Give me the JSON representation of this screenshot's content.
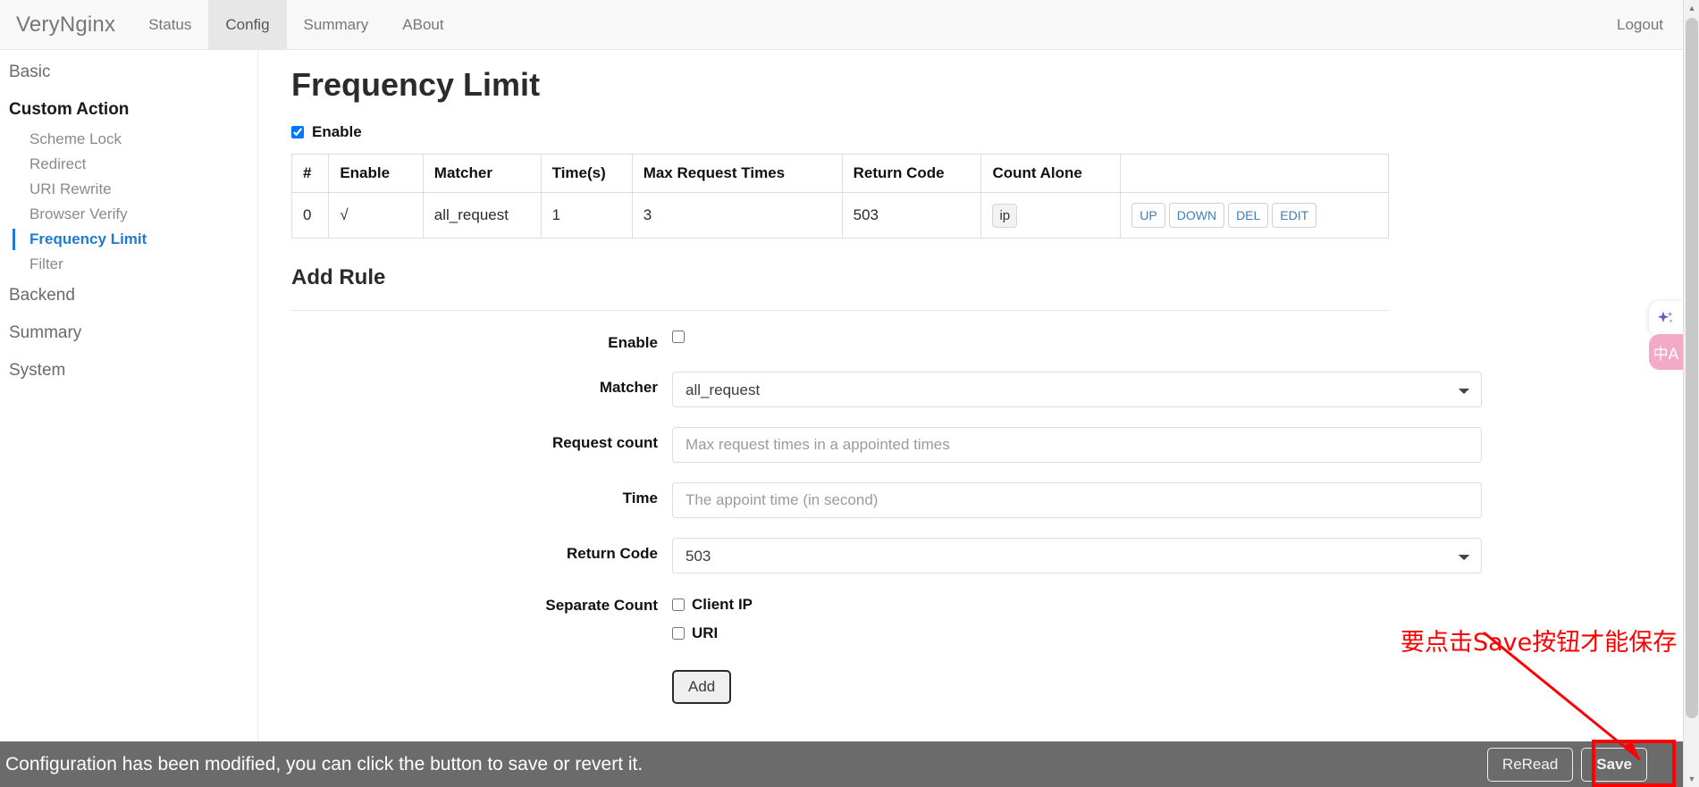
{
  "navbar": {
    "brand": "VeryNginx",
    "items": [
      {
        "label": "Status",
        "active": false
      },
      {
        "label": "Config",
        "active": true
      },
      {
        "label": "Summary",
        "active": false
      },
      {
        "label": "ABout",
        "active": false
      }
    ],
    "logout": "Logout"
  },
  "sidebar": {
    "basic": "Basic",
    "group": "Custom Action",
    "sub_items": [
      {
        "label": "Scheme Lock"
      },
      {
        "label": "Redirect"
      },
      {
        "label": "URI Rewrite"
      },
      {
        "label": "Browser Verify"
      },
      {
        "label": "Frequency Limit"
      },
      {
        "label": "Filter"
      }
    ],
    "backend": "Backend",
    "summary": "Summary",
    "system": "System",
    "active_label": "Frequency Limit",
    "accent_color": "#1f7ad4"
  },
  "main": {
    "page_title": "Frequency Limit",
    "enable_label": "Enable",
    "enable_checked": true,
    "table": {
      "headers": [
        "#",
        "Enable",
        "Matcher",
        "Time(s)",
        "Max Request Times",
        "Return Code",
        "Count Alone",
        ""
      ],
      "rows": [
        {
          "index": "0",
          "enable": "√",
          "matcher": "all_request",
          "time": "1",
          "max_request_times": "3",
          "return_code": "503",
          "count_alone": "ip",
          "actions": [
            "UP",
            "DOWN",
            "DEL",
            "EDIT"
          ]
        }
      ]
    },
    "add_rule_title": "Add Rule",
    "form": {
      "enable": {
        "label": "Enable",
        "checked": false
      },
      "matcher": {
        "label": "Matcher",
        "value": "all_request",
        "options": [
          "all_request"
        ]
      },
      "request_count": {
        "label": "Request count",
        "value": "",
        "placeholder": "Max request times in a appointed times"
      },
      "time": {
        "label": "Time",
        "value": "",
        "placeholder": "The appoint time (in second)"
      },
      "return_code": {
        "label": "Return Code",
        "value": "503",
        "options": [
          "503"
        ]
      },
      "separate_count": {
        "label": "Separate Count",
        "options": [
          {
            "label": "Client IP",
            "checked": false
          },
          {
            "label": "URI",
            "checked": false
          }
        ]
      },
      "add_button": "Add"
    }
  },
  "bottombar": {
    "message": "Configuration has been modified, you can click the button to save or revert it.",
    "reread_label": "ReRead",
    "save_label": "Save",
    "background": "#6b6b6b"
  },
  "annotation": {
    "text": "要点击Save按钮才能保存",
    "color": "#ff0000"
  },
  "floating": {
    "ai_icon": "✦",
    "translate_icon": "中A"
  }
}
